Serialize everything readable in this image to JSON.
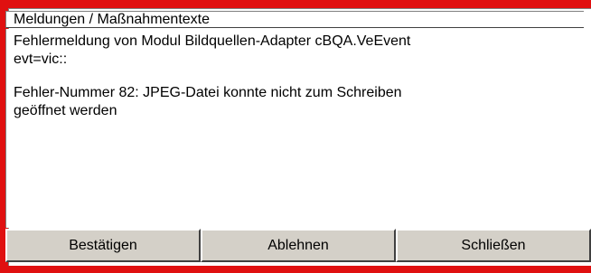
{
  "header": {
    "title": "Meldungen / Maßnahmentexte"
  },
  "message": {
    "line1": "Fehlermeldung von Modul Bildquellen-Adapter cBQA.VeEvent",
    "line2": "evt=vic::",
    "line3": "Fehler-Nummer 82: JPEG-Datei konnte nicht zum Schreiben",
    "line4": "geöffnet werden"
  },
  "buttons": {
    "confirm_label": "Bestätigen",
    "reject_label": "Ablehnen",
    "close_label": "Schließen"
  },
  "colors": {
    "alert_border": "#e01010",
    "button_face": "#d4d0c8"
  }
}
